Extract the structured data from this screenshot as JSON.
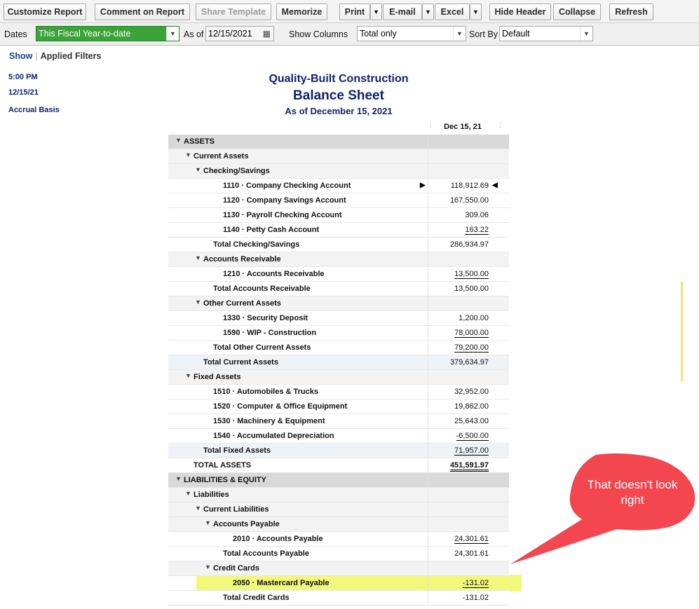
{
  "toolbar": {
    "customize": "Customize Report",
    "comment": "Comment on Report",
    "share": "Share Template",
    "memorize": "Memorize",
    "print": "Print",
    "email": "E-mail",
    "excel": "Excel",
    "hide_header": "Hide Header",
    "collapse": "Collapse",
    "refresh": "Refresh"
  },
  "filters": {
    "dates_label": "Dates",
    "dates_value": "This Fiscal Year-to-date",
    "as_of_label": "As of",
    "as_of_value": "12/15/2021",
    "show_columns_label": "Show Columns",
    "show_columns_value": "Total only",
    "sort_by_label": "Sort By",
    "sort_by_value": "Default"
  },
  "show_link": "Show",
  "applied_filters": "Applied Filters",
  "meta": {
    "time": "5:00 PM",
    "date": "12/15/21",
    "basis": "Accrual Basis"
  },
  "report": {
    "company": "Quality-Built Construction",
    "title": "Balance Sheet",
    "subtitle": "As of December 15, 2021",
    "column": "Dec 15, 21",
    "rows": [
      {
        "label": "ASSETS",
        "value": ""
      },
      {
        "label": "Current Assets",
        "value": ""
      },
      {
        "label": "Checking/Savings",
        "value": ""
      },
      {
        "label": "1110 · Company Checking Account",
        "value": "118,912.69"
      },
      {
        "label": "1120 · Company Savings Account",
        "value": "167,550.00"
      },
      {
        "label": "1130 · Payroll Checking Account",
        "value": "309.06"
      },
      {
        "label": "1140 · Petty Cash Account",
        "value": "163.22"
      },
      {
        "label": "Total Checking/Savings",
        "value": "286,934.97"
      },
      {
        "label": "Accounts Receivable",
        "value": ""
      },
      {
        "label": "1210 · Accounts Receivable",
        "value": "13,500.00"
      },
      {
        "label": "Total Accounts Receivable",
        "value": "13,500.00"
      },
      {
        "label": "Other Current Assets",
        "value": ""
      },
      {
        "label": "1330 · Security Deposit",
        "value": "1,200.00"
      },
      {
        "label": "1590 · WIP - Construction",
        "value": "78,000.00"
      },
      {
        "label": "Total Other Current Assets",
        "value": "79,200.00"
      },
      {
        "label": "Total Current Assets",
        "value": "379,634.97"
      },
      {
        "label": "Fixed Assets",
        "value": ""
      },
      {
        "label": "1510 · Automobiles & Trucks",
        "value": "32,952.00"
      },
      {
        "label": "1520 · Computer & Office Equipment",
        "value": "19,862.00"
      },
      {
        "label": "1530 · Machinery & Equipment",
        "value": "25,643.00"
      },
      {
        "label": "1540 · Accumulated Depreciation",
        "value": "-6,500.00"
      },
      {
        "label": "Total Fixed Assets",
        "value": "71,957.00"
      },
      {
        "label": "TOTAL ASSETS",
        "value": "451,591.97"
      },
      {
        "label": "LIABILITIES & EQUITY",
        "value": ""
      },
      {
        "label": "Liabilities",
        "value": ""
      },
      {
        "label": "Current Liabilities",
        "value": ""
      },
      {
        "label": "Accounts Payable",
        "value": ""
      },
      {
        "label": "2010 · Accounts Payable",
        "value": "24,301.61"
      },
      {
        "label": "Total Accounts Payable",
        "value": "24,301.61"
      },
      {
        "label": "Credit Cards",
        "value": ""
      },
      {
        "label": "2050 · Mastercard Payable",
        "value": "-131.02"
      },
      {
        "label": "Total Credit Cards",
        "value": "-131.02"
      }
    ]
  },
  "callout": {
    "text": "That doesn't look right",
    "color": "#f4464f"
  }
}
